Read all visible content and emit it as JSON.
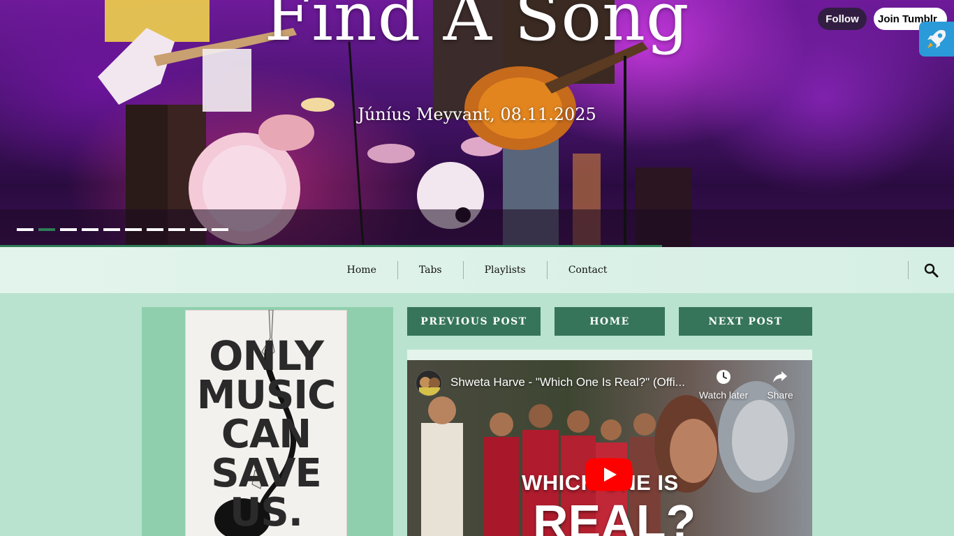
{
  "hero": {
    "title": "Find A Song",
    "caption": "Júníus Meyvant, 08.11.2025",
    "slide_count": 10,
    "active_slide": 2
  },
  "tumblr": {
    "follow_label": "Follow",
    "join_label": "Join Tumblr"
  },
  "nav": {
    "items": [
      {
        "label": "Home"
      },
      {
        "label": "Tabs"
      },
      {
        "label": "Playlists"
      },
      {
        "label": "Contact"
      }
    ]
  },
  "poster": {
    "lines": [
      "ONLY",
      "MUSIC",
      "CAN",
      "SAVE",
      "US."
    ]
  },
  "post_nav": {
    "previous_label": "PREVIOUS POST",
    "home_label": "HOME",
    "next_label": "NEXT POST"
  },
  "video": {
    "title": "Shweta Harve - \"Which One Is Real?\" (Offi...",
    "watch_later_label": "Watch later",
    "share_label": "Share",
    "thumbnail_line1": "WHICH ONE IS",
    "thumbnail_line2": "REAL?"
  },
  "colors": {
    "accent_green": "#36755a",
    "page_background": "#b9e3cf",
    "youtube_red": "#ff0000"
  }
}
